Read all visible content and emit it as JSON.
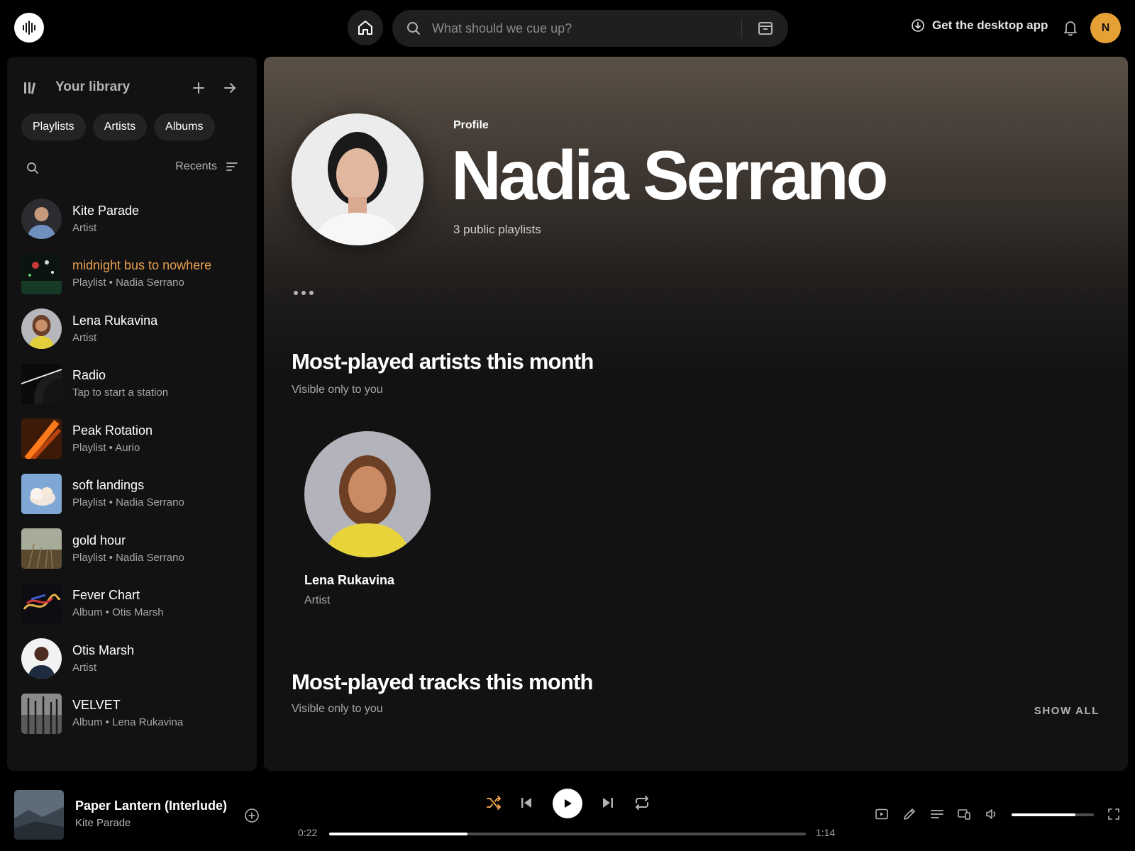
{
  "colors": {
    "accent": "#e8a050",
    "avatar_bg": "#e5a036",
    "background": "#000000",
    "panel": "#121212"
  },
  "topbar": {
    "logo_icon": "soundwave-icon",
    "home_icon": "home-icon",
    "search_placeholder": "What should we cue up?",
    "browse_icon": "browse-icon",
    "desktop_app_label": "Get the desktop app",
    "notifications_icon": "bell-icon",
    "avatar_initial": "N"
  },
  "library": {
    "title": "Your library",
    "filters": [
      "Playlists",
      "Artists",
      "Albums"
    ],
    "sort_label": "Recents",
    "items": [
      {
        "name": "Kite Parade",
        "sub": "Artist",
        "active": false
      },
      {
        "name": "midnight bus to nowhere",
        "sub": "Playlist • Nadia Serrano",
        "active": true
      },
      {
        "name": "Lena Rukavina",
        "sub": "Artist",
        "active": false
      },
      {
        "name": "Radio",
        "sub": "Tap to start a station",
        "active": false
      },
      {
        "name": "Peak Rotation",
        "sub": "Playlist • Aurio",
        "active": false
      },
      {
        "name": "soft landings",
        "sub": "Playlist • Nadia Serrano",
        "active": false
      },
      {
        "name": "gold hour",
        "sub": "Playlist • Nadia Serrano",
        "active": false
      },
      {
        "name": "Fever Chart",
        "sub": "Album • Otis Marsh",
        "active": false
      },
      {
        "name": "Otis Marsh",
        "sub": "Artist",
        "active": false
      },
      {
        "name": "VELVET",
        "sub": "Album • Lena Rukavina",
        "active": false
      }
    ]
  },
  "profile": {
    "label": "Profile",
    "name": "Nadia Serrano",
    "meta": "3 public playlists"
  },
  "top_artists": {
    "title": "Most-played artists this month",
    "subtitle": "Visible only to you",
    "artists": [
      {
        "name": "Lena Rukavina",
        "sub": "Artist"
      }
    ]
  },
  "top_tracks": {
    "title": "Most-played tracks this month",
    "subtitle": "Visible only to you",
    "show_all": "SHOW ALL"
  },
  "player": {
    "title": "Paper Lantern (Interlude)",
    "artist": "Kite Parade",
    "elapsed": "0:22",
    "duration": "1:14",
    "progress": 0.29,
    "volume": 0.78,
    "shuffle_active": true
  }
}
